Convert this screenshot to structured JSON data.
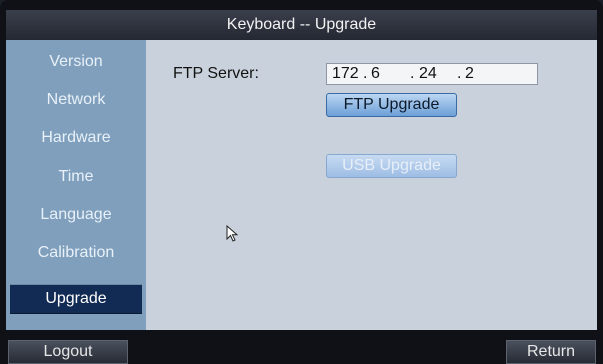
{
  "window": {
    "title": "Keyboard -- Upgrade"
  },
  "sidebar": {
    "items": [
      {
        "label": "Version"
      },
      {
        "label": "Network"
      },
      {
        "label": "Hardware"
      },
      {
        "label": "Time"
      },
      {
        "label": "Language"
      },
      {
        "label": "Calibration"
      },
      {
        "label": "Upgrade"
      }
    ],
    "active": "Upgrade"
  },
  "main": {
    "ftp_server_label": "FTP Server:",
    "ftp_server_ip": {
      "seg1": "172",
      "seg2": "6",
      "seg3": "24",
      "seg4": "2"
    },
    "ftp_upgrade_label": "FTP Upgrade",
    "usb_upgrade_label": "USB Upgrade",
    "usb_upgrade_enabled": false
  },
  "footer": {
    "logout_label": "Logout",
    "return_label": "Return"
  },
  "colors": {
    "sidebar_bg": "#7f9fbd",
    "sidebar_active_bg": "#122b55",
    "main_bg": "#c9d2dc",
    "titlebar_bg": "#2e3340",
    "button_accent": "#6c9fd7"
  }
}
